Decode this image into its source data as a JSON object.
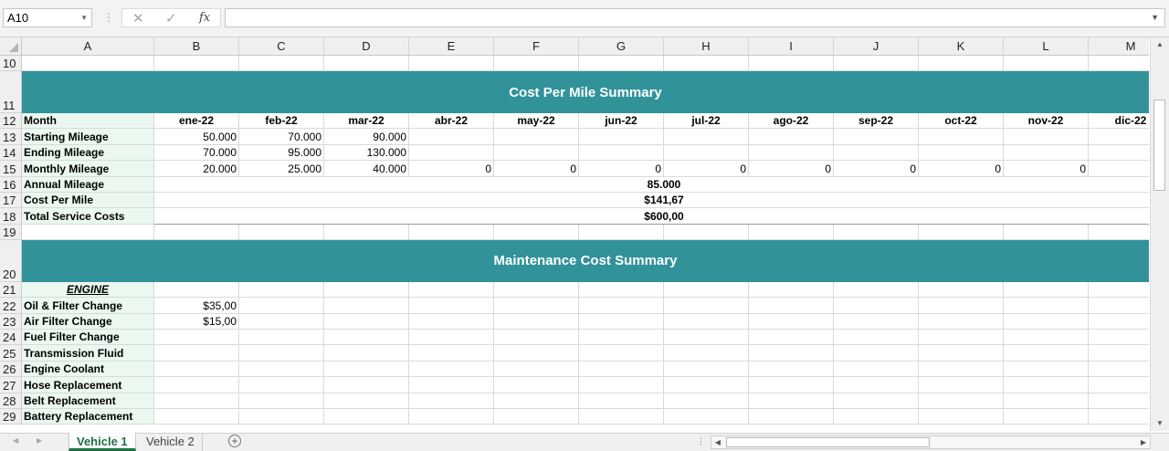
{
  "name_box": {
    "value": "A10"
  },
  "formula_bar": {
    "fx": "fx",
    "value": ""
  },
  "columns": [
    "A",
    "B",
    "C",
    "D",
    "E",
    "F",
    "G",
    "H",
    "I",
    "J",
    "K",
    "L",
    "M"
  ],
  "rows": [
    {
      "num": "10",
      "type": "blank"
    },
    {
      "num": "11",
      "type": "banner",
      "text": "Cost Per Mile Summary"
    },
    {
      "num": "12",
      "type": "months",
      "label": "Month",
      "values": [
        "ene-22",
        "feb-22",
        "mar-22",
        "abr-22",
        "may-22",
        "jun-22",
        "jul-22",
        "ago-22",
        "sep-22",
        "oct-22",
        "nov-22",
        "dic-22"
      ]
    },
    {
      "num": "13",
      "type": "data",
      "label": "Starting Mileage",
      "values": [
        "50.000",
        "70.000",
        "90.000",
        "",
        "",
        "",
        "",
        "",
        "",
        "",
        "",
        ""
      ]
    },
    {
      "num": "14",
      "type": "data",
      "label": "Ending Mileage",
      "values": [
        "70.000",
        "95.000",
        "130.000",
        "",
        "",
        "",
        "",
        "",
        "",
        "",
        "",
        ""
      ]
    },
    {
      "num": "15",
      "type": "data",
      "label": "Monthly Mileage",
      "values": [
        "20.000",
        "25.000",
        "40.000",
        "0",
        "0",
        "0",
        "0",
        "0",
        "0",
        "0",
        "0",
        ""
      ]
    },
    {
      "num": "16",
      "type": "merged",
      "label": "Annual Mileage",
      "value": "85.000"
    },
    {
      "num": "17",
      "type": "merged",
      "label": "Cost Per Mile",
      "value": "$141,67"
    },
    {
      "num": "18",
      "type": "merged",
      "label": "Total Service Costs",
      "value": "$600,00"
    },
    {
      "num": "19",
      "type": "blank"
    },
    {
      "num": "20",
      "type": "banner",
      "text": "Maintenance Cost Summary"
    },
    {
      "num": "21",
      "type": "section",
      "label": "ENGINE"
    },
    {
      "num": "22",
      "type": "data",
      "label": "Oil & Filter Change",
      "values": [
        "$35,00",
        "",
        "",
        "",
        "",
        "",
        "",
        "",
        "",
        "",
        "",
        ""
      ]
    },
    {
      "num": "23",
      "type": "data",
      "label": "Air Filter Change",
      "values": [
        "$15,00",
        "",
        "",
        "",
        "",
        "",
        "",
        "",
        "",
        "",
        "",
        ""
      ]
    },
    {
      "num": "24",
      "type": "data",
      "label": "Fuel Filter Change",
      "values": [
        "",
        "",
        "",
        "",
        "",
        "",
        "",
        "",
        "",
        "",
        "",
        ""
      ]
    },
    {
      "num": "25",
      "type": "data",
      "label": "Transmission Fluid",
      "values": [
        "",
        "",
        "",
        "",
        "",
        "",
        "",
        "",
        "",
        "",
        "",
        ""
      ]
    },
    {
      "num": "26",
      "type": "data",
      "label": "Engine Coolant",
      "values": [
        "",
        "",
        "",
        "",
        "",
        "",
        "",
        "",
        "",
        "",
        "",
        ""
      ]
    },
    {
      "num": "27",
      "type": "data",
      "label": "Hose Replacement",
      "values": [
        "",
        "",
        "",
        "",
        "",
        "",
        "",
        "",
        "",
        "",
        "",
        ""
      ]
    },
    {
      "num": "28",
      "type": "data",
      "label": "Belt Replacement",
      "values": [
        "",
        "",
        "",
        "",
        "",
        "",
        "",
        "",
        "",
        "",
        "",
        ""
      ]
    },
    {
      "num": "29",
      "type": "data",
      "label": "Battery Replacement",
      "values": [
        "",
        "",
        "",
        "",
        "",
        "",
        "",
        "",
        "",
        "",
        "",
        ""
      ]
    }
  ],
  "sheet_tabs": [
    {
      "label": "Vehicle 1",
      "active": true
    },
    {
      "label": "Vehicle 2",
      "active": false
    }
  ],
  "colors": {
    "banner": "#31929a",
    "label_fill": "#eaf8ef",
    "active_tab": "#1e7145"
  }
}
